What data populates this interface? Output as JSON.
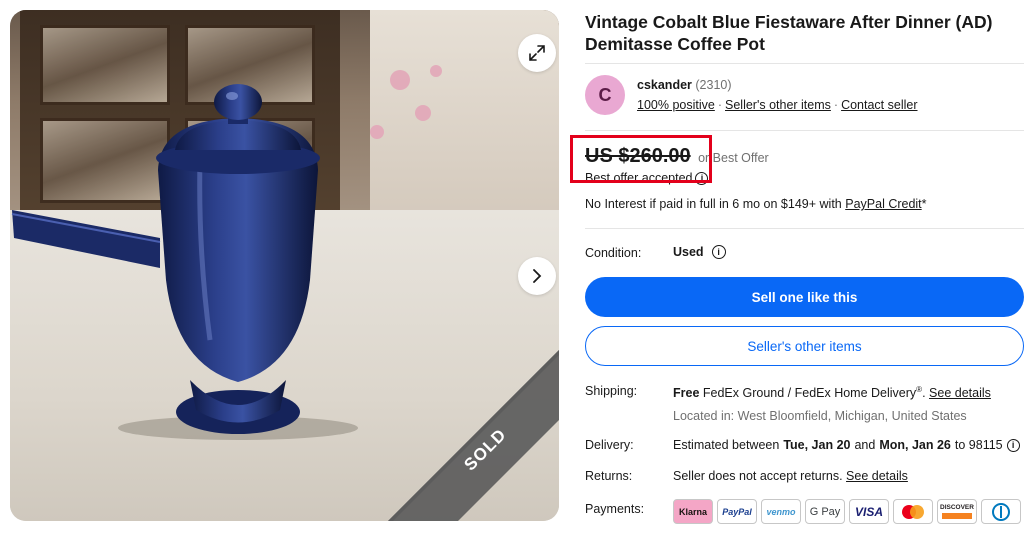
{
  "image": {
    "sold_label": "SOLD",
    "expand_icon": "expand-icon",
    "next_icon": "chevron-right-icon"
  },
  "listing": {
    "title": "Vintage Cobalt Blue Fiestaware After Dinner (AD) Demitasse Coffee Pot"
  },
  "seller": {
    "avatar_letter": "C",
    "name": "cskander",
    "feedback_count": "(2310)",
    "positive": "100% positive",
    "other_items": "Seller's other items",
    "contact": "Contact seller"
  },
  "price": {
    "amount": "US $260.00",
    "offer_label": "or Best Offer",
    "offer_status": "Best offer accepted",
    "financing_prefix": "No Interest if paid in full in 6 mo on $149+ with",
    "financing_link": "PayPal Credit",
    "financing_suffix": "*"
  },
  "condition": {
    "label": "Condition:",
    "value": "Used"
  },
  "buttons": {
    "sell_one": "Sell one like this",
    "seller_items": "Seller's other items"
  },
  "shipping": {
    "label": "Shipping:",
    "free": "Free",
    "method": "FedEx Ground / FedEx Home Delivery",
    "reg_mark": "®",
    "separator": ".",
    "details_link": "See details",
    "location": "Located in: West Bloomfield, Michigan, United States"
  },
  "delivery": {
    "label": "Delivery:",
    "prefix": "Estimated between",
    "start": "Tue, Jan 20",
    "and": "and",
    "end": "Mon, Jan 26",
    "suffix": "to 98115"
  },
  "returns": {
    "label": "Returns:",
    "text": "Seller does not accept returns.",
    "details_link": "See details"
  },
  "payments": {
    "label": "Payments:",
    "methods": [
      "Klarna",
      "PayPal",
      "venmo",
      "G Pay",
      "VISA",
      "Mastercard",
      "DISCOVER",
      "Diners Club"
    ]
  },
  "colors": {
    "accent": "#0968f6",
    "highlight": "#e3001b",
    "avatar": "#e9a8d2",
    "pot": "#1e2f6e"
  }
}
